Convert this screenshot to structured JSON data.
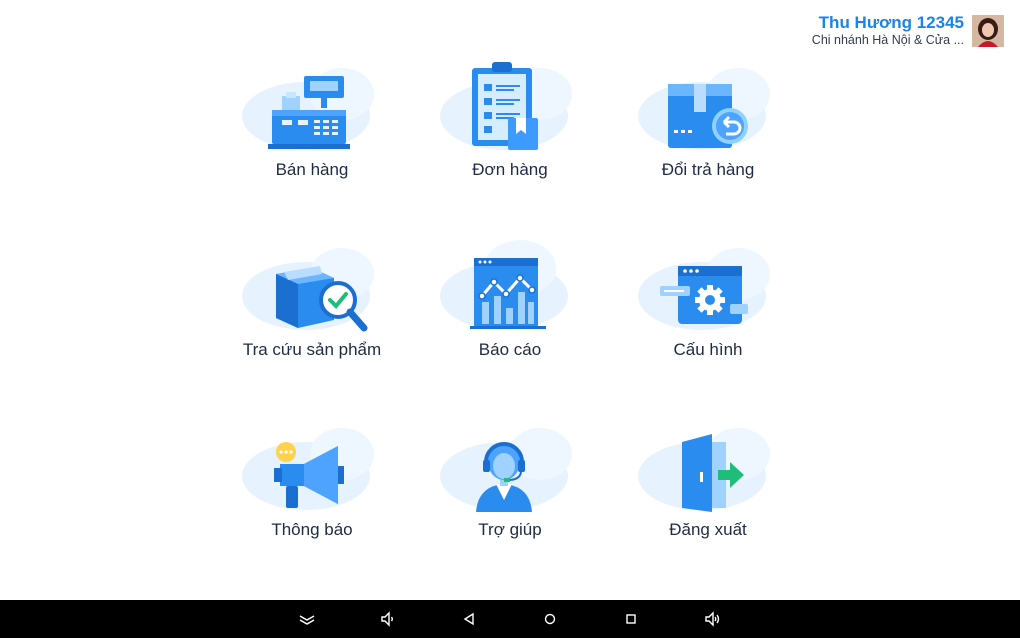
{
  "user": {
    "name": "Thu Hương 12345",
    "branch": "Chi nhánh Hà Nội & Cửa ..."
  },
  "menu": [
    {
      "key": "sales",
      "label": "Bán hàng",
      "icon": "cash-register-icon"
    },
    {
      "key": "orders",
      "label": "Đơn hàng",
      "icon": "clipboard-icon"
    },
    {
      "key": "returns",
      "label": "Đổi trả hàng",
      "icon": "return-box-icon"
    },
    {
      "key": "lookup",
      "label": "Tra cứu sản phẩm",
      "icon": "product-search-icon"
    },
    {
      "key": "reports",
      "label": "Báo cáo",
      "icon": "report-chart-icon"
    },
    {
      "key": "settings",
      "label": "Cấu hình",
      "icon": "settings-gear-icon"
    },
    {
      "key": "notifications",
      "label": "Thông báo",
      "icon": "megaphone-icon"
    },
    {
      "key": "help",
      "label": "Trợ giúp",
      "icon": "support-agent-icon"
    },
    {
      "key": "logout",
      "label": "Đăng xuất",
      "icon": "logout-door-icon"
    }
  ],
  "navbar": [
    "collapse-icon",
    "volume-down-icon",
    "back-icon",
    "home-icon",
    "recents-icon",
    "volume-up-icon"
  ],
  "colors": {
    "accent": "#1a84e8",
    "icon_blue": "#2b8cf0",
    "icon_light": "#e6f3ff",
    "text": "#1e2b44",
    "navbar": "#000000"
  }
}
